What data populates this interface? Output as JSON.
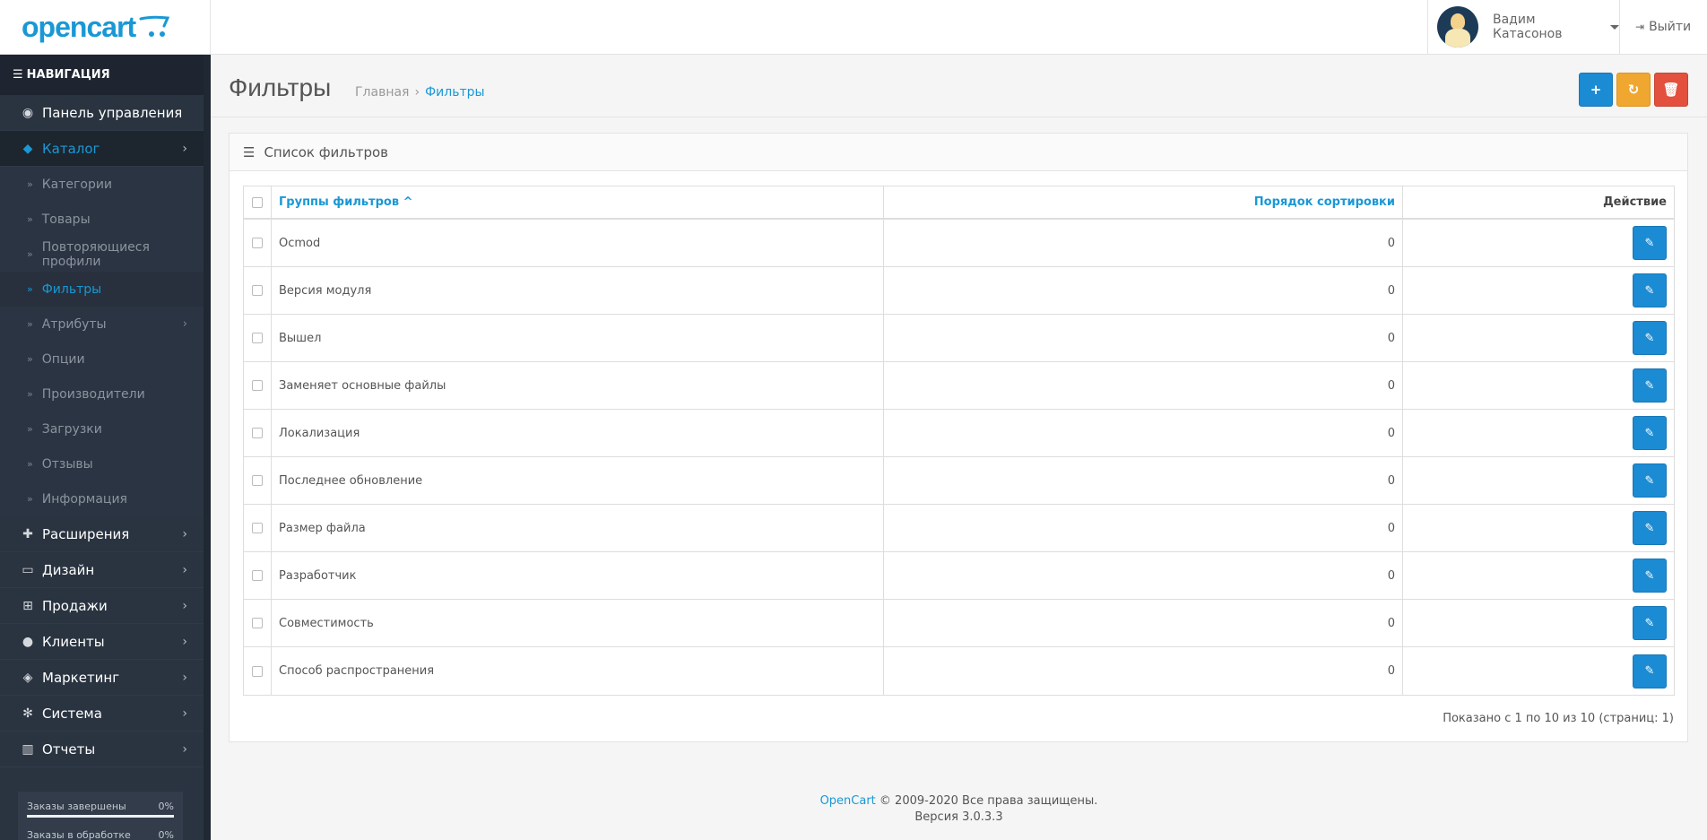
{
  "header": {
    "logo_text": "opencart",
    "user_name": "Вадим Катасонов",
    "logout_label": "Выйти"
  },
  "sidebar": {
    "title": "НАВИГАЦИЯ",
    "items": [
      {
        "label": "Панель управления",
        "icon": "dashboard-icon"
      },
      {
        "label": "Каталог",
        "icon": "tags-icon",
        "active": true
      },
      {
        "label": "Расширения",
        "icon": "puzzle-icon"
      },
      {
        "label": "Дизайн",
        "icon": "monitor-icon"
      },
      {
        "label": "Продажи",
        "icon": "cart-icon"
      },
      {
        "label": "Клиенты",
        "icon": "user-icon"
      },
      {
        "label": "Маркетинг",
        "icon": "share-icon"
      },
      {
        "label": "Система",
        "icon": "gear-icon"
      },
      {
        "label": "Отчеты",
        "icon": "bar-chart-icon"
      }
    ],
    "catalog_sub": [
      {
        "label": "Категории"
      },
      {
        "label": "Товары"
      },
      {
        "label": "Повторяющиеся профили"
      },
      {
        "label": "Фильтры",
        "active": true
      },
      {
        "label": "Атрибуты"
      },
      {
        "label": "Опции"
      },
      {
        "label": "Производители"
      },
      {
        "label": "Загрузки"
      },
      {
        "label": "Отзывы"
      },
      {
        "label": "Информация"
      }
    ],
    "stats": [
      {
        "label": "Заказы завершены",
        "pct": "0%"
      },
      {
        "label": "Заказы в обработке",
        "pct": "0%"
      }
    ]
  },
  "page": {
    "title": "Фильтры",
    "breadcrumb": [
      "Главная",
      "Фильтры"
    ]
  },
  "panel": {
    "heading": "Список фильтров",
    "columns": {
      "name": "Группы фильтров",
      "sort": "Порядок сортировки",
      "action": "Действие"
    },
    "rows": [
      {
        "name": "Ocmod",
        "sort": "0"
      },
      {
        "name": "Версия модуля",
        "sort": "0"
      },
      {
        "name": "Вышел",
        "sort": "0"
      },
      {
        "name": "Заменяет основные файлы",
        "sort": "0"
      },
      {
        "name": "Локализация",
        "sort": "0"
      },
      {
        "name": "Последнее обновление",
        "sort": "0"
      },
      {
        "name": "Размер файла",
        "sort": "0"
      },
      {
        "name": "Разработчик",
        "sort": "0"
      },
      {
        "name": "Совместимость",
        "sort": "0"
      },
      {
        "name": "Способ распространения",
        "sort": "0"
      }
    ],
    "pagination_text": "Показано с 1 по 10 из 10 (страниц: 1)"
  },
  "footer": {
    "brand": "OpenCart",
    "copyright": "© 2009-2020 Все права защищены.",
    "version": "Версия 3.0.3.3"
  },
  "colors": {
    "accent": "#1a98d5",
    "sidebar_bg": "#2a3441",
    "btn_add": "#1b8bd3",
    "btn_refresh": "#f0a730",
    "btn_delete": "#e3503e"
  }
}
